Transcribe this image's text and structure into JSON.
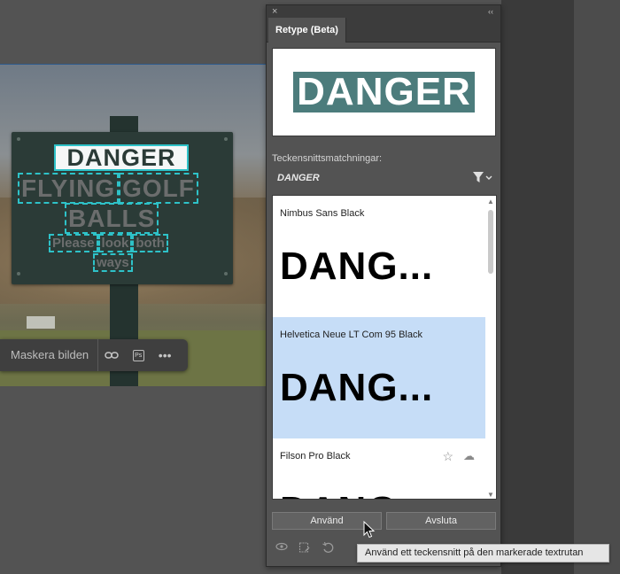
{
  "canvas": {
    "sign": {
      "line1": "DANGER",
      "line2": [
        "FLYING",
        "GOLF"
      ],
      "line3": "BALLS",
      "line4": [
        "Please",
        "look",
        "both"
      ],
      "line5": "ways"
    },
    "mask_toolbar": {
      "mask_label": "Maskera bilden",
      "icons": [
        "link-icon",
        "ps-badge-icon",
        "more-icon"
      ],
      "ps_label": "Ps",
      "more_label": "•••"
    }
  },
  "panel": {
    "close_glyph": "×",
    "collapse_glyph": "‹‹",
    "tab_label": "Retype (Beta)",
    "preview_text": "DANGER",
    "matches_label": "Teckensnittsmatchningar:",
    "filter_text": "DANGER",
    "fonts": [
      {
        "name": "Nimbus Sans Black",
        "sample": "DANG...",
        "selected": false
      },
      {
        "name": "Helvetica Neue LT Com 95 Black",
        "sample": "DANG...",
        "selected": true
      },
      {
        "name": "Filson Pro Black",
        "sample": "DANG...",
        "selected": false
      }
    ],
    "apply_label": "Använd",
    "exit_label": "Avsluta"
  },
  "tooltip": "Använd ett teckensnitt på den markerade textrutan",
  "colors": {
    "selection_border": "#2ec2c8",
    "selected_row": "#c6ddf7",
    "preview_fill": "#4c7c7c"
  }
}
